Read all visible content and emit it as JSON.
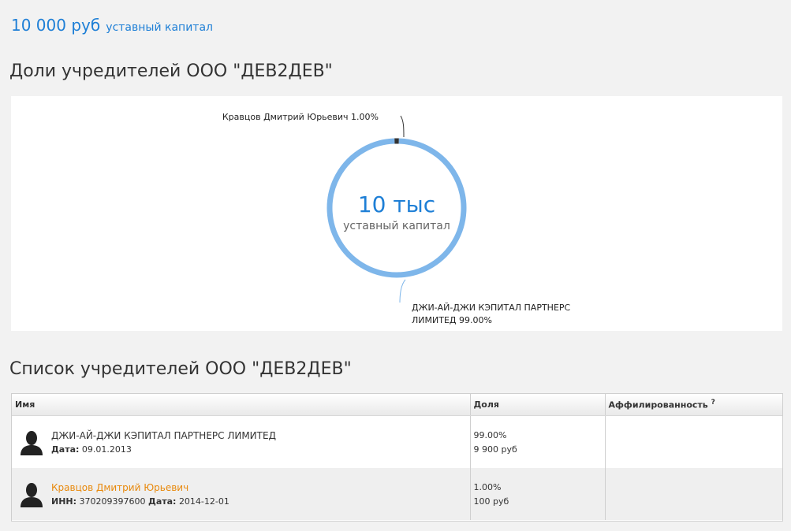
{
  "capital": {
    "amount": "10 000 руб",
    "label": "уставный капитал"
  },
  "shares_heading": "Доли учредителей ООО \"ДЕВ2ДЕВ\"",
  "chart": {
    "center_value": "10 тыс",
    "center_label": "уставный капитал",
    "label_small": "Кравцов Дмитрий Юрьевич 1.00%",
    "label_big_line1": "ДЖИ-АЙ-ДЖИ КЭПИТАЛ ПАРТНЕРС",
    "label_big_line2": "ЛИМИТЕД 99.00%",
    "colors": {
      "major": "#7eb6ea",
      "minor": "#333333",
      "value": "#1e7fd6"
    }
  },
  "chart_data": {
    "type": "pie",
    "categories": [
      "ДЖИ-АЙ-ДЖИ КЭПИТАЛ ПАРТНЕРС ЛИМИТЕД",
      "Кравцов Дмитрий Юрьевич"
    ],
    "values": [
      99.0,
      1.0
    ]
  },
  "list_heading": "Список учредителей ООО \"ДЕВ2ДЕВ\"",
  "table": {
    "headers": {
      "name": "Имя",
      "share": "Доля",
      "affiliation": "Аффилированность",
      "help": "?"
    },
    "rows": [
      {
        "name": "ДЖИ-АЙ-ДЖИ КЭПИТАЛ ПАРТНЕРС ЛИМИТЕД",
        "date_label": "Дата:",
        "date": "09.01.2013",
        "share_pct": "99.00%",
        "share_rub": "9 900 руб"
      },
      {
        "name": "Кравцов Дмитрий Юрьевич",
        "inn_label": "ИНН:",
        "inn": "370209397600",
        "date_label": "Дата:",
        "date": "2014-12-01",
        "share_pct": "1.00%",
        "share_rub": "100 руб"
      }
    ]
  }
}
